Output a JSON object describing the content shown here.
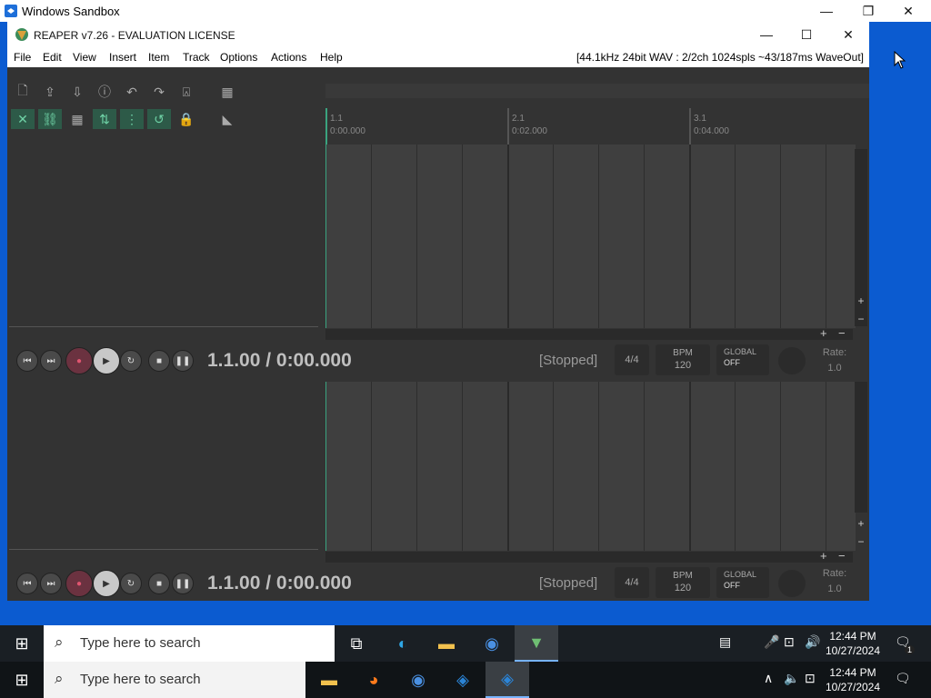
{
  "sandbox": {
    "title": "Windows Sandbox"
  },
  "reaper": {
    "title": "REAPER v7.26 - EVALUATION LICENSE",
    "menu": [
      "File",
      "Edit",
      "View",
      "Insert",
      "Item",
      "Track",
      "Options",
      "Actions",
      "Help"
    ],
    "status": "[44.1kHz 24bit WAV : 2/2ch 1024spls ~43/187ms WaveOut]",
    "ruler": [
      {
        "bar": "1.1",
        "time": "0:00.000"
      },
      {
        "bar": "2.1",
        "time": "0:02.000"
      },
      {
        "bar": "3.1",
        "time": "0:04.000"
      }
    ],
    "transport": {
      "time": "1.1.00 / 0:00.000",
      "state": "[Stopped]",
      "timesig": "4/4",
      "bpm_label": "BPM",
      "bpm_value": "120",
      "global_label": "GLOBAL",
      "global_value": "OFF",
      "rate_label": "Rate:",
      "rate_value": "1.0"
    }
  },
  "taskbar_top": {
    "search_placeholder": "Type here to search",
    "time": "12:44 PM",
    "date": "10/27/2024",
    "notif_count": "1"
  },
  "taskbar_bottom": {
    "search_placeholder": "Type here to search",
    "time": "12:44 PM",
    "date": "10/27/2024"
  }
}
